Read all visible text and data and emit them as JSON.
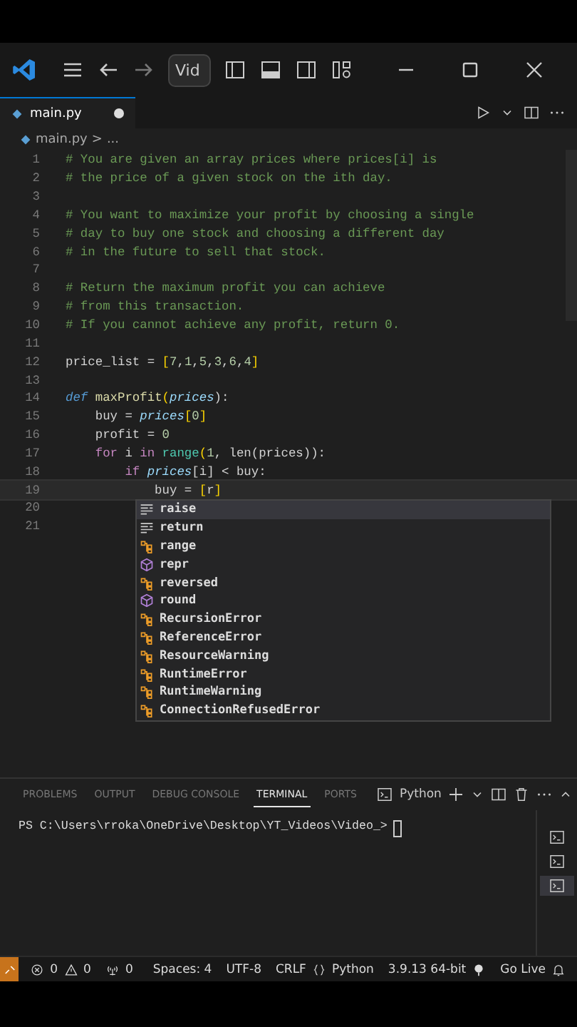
{
  "title_bar": {
    "search": "Vid"
  },
  "tabs": [
    {
      "label": "main.py",
      "selected": true,
      "modified": true
    }
  ],
  "breadcrumb": {
    "file": "main.py",
    "separator": ">",
    "rest": "..."
  },
  "code_lines": [
    {
      "number": "1",
      "tokens": [
        {
          "text": "# You are given an array prices where prices[i] is",
          "kind": "comment"
        }
      ]
    },
    {
      "number": "2",
      "tokens": [
        {
          "text": "# the price of a given stock on the ith day.",
          "kind": "comment"
        }
      ]
    },
    {
      "number": "3"
    },
    {
      "number": "4",
      "tokens": [
        {
          "text": "# You want to maximize your profit by choosing a single",
          "kind": "comment"
        }
      ]
    },
    {
      "number": "5",
      "tokens": [
        {
          "text": "# day to buy one stock and choosing a different day",
          "kind": "comment"
        }
      ]
    },
    {
      "number": "6",
      "tokens": [
        {
          "text": "# in the future to sell that stock.",
          "kind": "comment"
        }
      ]
    },
    {
      "number": "7"
    },
    {
      "number": "8",
      "tokens": [
        {
          "text": "# Return the maximum profit you can achieve",
          "kind": "comment"
        }
      ]
    },
    {
      "number": "9",
      "tokens": [
        {
          "text": "# from this transaction.",
          "kind": "comment"
        }
      ]
    },
    {
      "number": "10",
      "tokens": [
        {
          "text": "# If you cannot achieve any profit, return 0.",
          "kind": "comment"
        }
      ]
    },
    {
      "number": "11"
    },
    {
      "number": "12",
      "tokens": [
        {
          "text": "price_list ",
          "kind": "plain"
        },
        {
          "text": "= ",
          "kind": "op"
        },
        {
          "text": "[",
          "kind": "bracket"
        },
        {
          "text": "7",
          "kind": "number"
        },
        {
          "text": ",",
          "kind": "plain"
        },
        {
          "text": "1",
          "kind": "number"
        },
        {
          "text": ",",
          "kind": "plain"
        },
        {
          "text": "5",
          "kind": "number"
        },
        {
          "text": ",",
          "kind": "plain"
        },
        {
          "text": "3",
          "kind": "number"
        },
        {
          "text": ",",
          "kind": "plain"
        },
        {
          "text": "6",
          "kind": "number"
        },
        {
          "text": ",",
          "kind": "plain"
        },
        {
          "text": "4",
          "kind": "number"
        },
        {
          "text": "]",
          "kind": "bracket"
        }
      ]
    },
    {
      "number": "13"
    },
    {
      "number": "14",
      "tokens": [
        {
          "text": "def ",
          "kind": "storage"
        },
        {
          "text": "maxProfit",
          "kind": "function"
        },
        {
          "text": "(",
          "kind": "bracket"
        },
        {
          "text": "prices",
          "kind": "param"
        },
        {
          "text": "):",
          "kind": "plain"
        }
      ]
    },
    {
      "number": "15",
      "tokens": [
        {
          "text": "    buy ",
          "kind": "plain"
        },
        {
          "text": "= ",
          "kind": "op"
        },
        {
          "text": "prices",
          "kind": "param"
        },
        {
          "text": "[",
          "kind": "bracket"
        },
        {
          "text": "0",
          "kind": "number"
        },
        {
          "text": "]",
          "kind": "bracket"
        }
      ]
    },
    {
      "number": "16",
      "tokens": [
        {
          "text": "    profit ",
          "kind": "plain"
        },
        {
          "text": "= ",
          "kind": "op"
        },
        {
          "text": "0",
          "kind": "number"
        }
      ]
    },
    {
      "number": "17",
      "tokens": [
        {
          "text": "    for ",
          "kind": "keyword"
        },
        {
          "text": "i ",
          "kind": "plain"
        },
        {
          "text": "in ",
          "kind": "keyword"
        },
        {
          "text": "range",
          "kind": "builtin"
        },
        {
          "text": "(",
          "kind": "bracket"
        },
        {
          "text": "1",
          "kind": "number"
        },
        {
          "text": ", len(prices)):",
          "kind": "plain"
        }
      ]
    },
    {
      "number": "18",
      "tokens": [
        {
          "text": "        if ",
          "kind": "keyword"
        },
        {
          "text": "prices",
          "kind": "param"
        },
        {
          "text": "[i] ",
          "kind": "plain"
        },
        {
          "text": "< ",
          "kind": "op"
        },
        {
          "text": "buy:",
          "kind": "plain"
        }
      ]
    },
    {
      "number": "19",
      "tokens": [
        {
          "text": "            buy ",
          "kind": "plain"
        },
        {
          "text": "= ",
          "kind": "op"
        },
        {
          "text": "[",
          "kind": "bracket"
        },
        {
          "text": "r",
          "kind": "plain"
        },
        {
          "text": "]",
          "kind": "bracket"
        }
      ]
    },
    {
      "number": "20"
    },
    {
      "number": "21"
    }
  ],
  "suggestions": [
    {
      "label": "raise",
      "kind": "keyword",
      "selected": true
    },
    {
      "label": "return",
      "kind": "keyword",
      "selected": false
    },
    {
      "label": "range",
      "kind": "class",
      "selected": false
    },
    {
      "label": "repr",
      "kind": "function",
      "selected": false
    },
    {
      "label": "reversed",
      "kind": "class",
      "selected": false
    },
    {
      "label": "round",
      "kind": "function",
      "selected": false
    },
    {
      "label": "RecursionError",
      "kind": "class",
      "selected": false
    },
    {
      "label": "ReferenceError",
      "kind": "class",
      "selected": false
    },
    {
      "label": "ResourceWarning",
      "kind": "class",
      "selected": false
    },
    {
      "label": "RuntimeError",
      "kind": "class",
      "selected": false
    },
    {
      "label": "RuntimeWarning",
      "kind": "class",
      "selected": false
    },
    {
      "label": "ConnectionRefusedError",
      "kind": "class",
      "selected": false
    }
  ],
  "panel": {
    "tabs": [
      {
        "label": "PROBLEMS",
        "selected": false
      },
      {
        "label": "OUTPUT",
        "selected": false
      },
      {
        "label": "DEBUG CONSOLE",
        "selected": false
      },
      {
        "label": "TERMINAL",
        "selected": true
      },
      {
        "label": "PORTS",
        "selected": false
      }
    ],
    "terminal_profile": "Python",
    "prompt": "PS C:\\Users\\rroka\\OneDrive\\Desktop\\YT_Videos\\Video_>"
  },
  "status_bar": {
    "errors": "0",
    "warnings": "0",
    "ports": "0",
    "items": [
      "Spaces: 4",
      "UTF-8",
      "CRLF"
    ],
    "language": "Python",
    "interpreter": "3.9.13 64-bit",
    "live": "Go Live"
  }
}
